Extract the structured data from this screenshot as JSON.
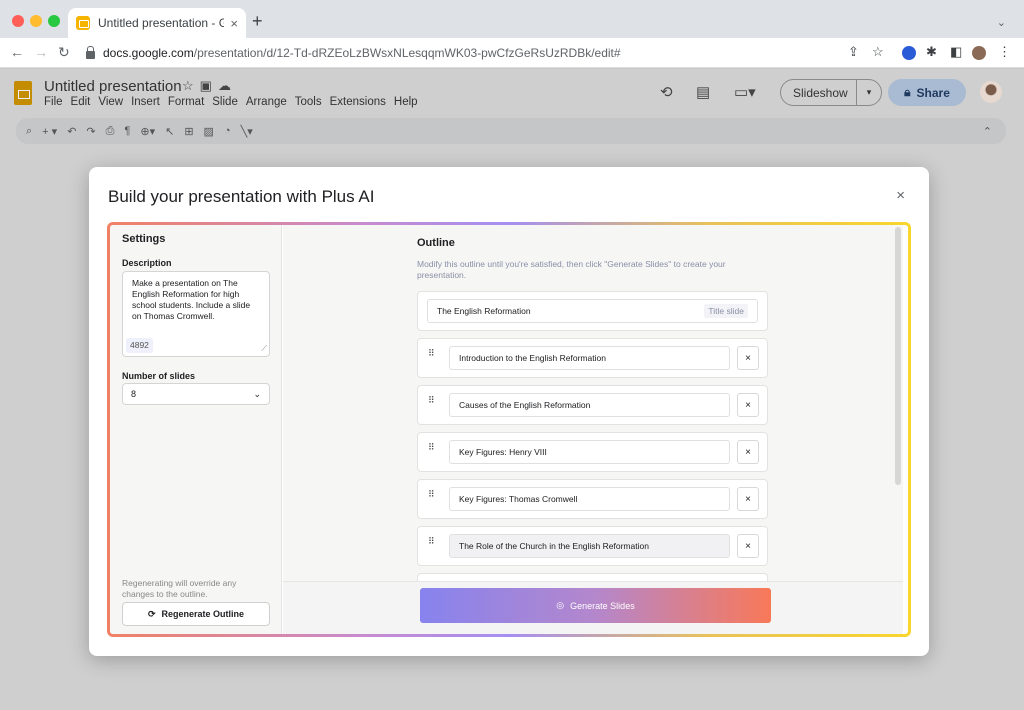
{
  "browser": {
    "tab_title": "Untitled presentation - Google",
    "tab_close": "×",
    "new_tab": "+",
    "url_host": "docs.google.com",
    "url_path": "/presentation/d/12-Td-dRZEoLzBWsxNLesqqmWK03-pwCfzGeRsUzRDBk/edit#"
  },
  "app": {
    "doc_title": "Untitled presentation",
    "menu": [
      "File",
      "Edit",
      "View",
      "Insert",
      "Format",
      "Slide",
      "Arrange",
      "Tools",
      "Extensions",
      "Help"
    ],
    "slideshow_label": "Slideshow",
    "share_label": "Share"
  },
  "modal": {
    "title": "Build your presentation with Plus AI",
    "close": "×"
  },
  "settings": {
    "title": "Settings",
    "description_label": "Description",
    "description_text": "Make a presentation on The English Reformation for high school students. Include a slide on Thomas Cromwell.",
    "char_count": "4892",
    "num_slides_label": "Number of slides",
    "num_slides_value": "8",
    "regen_note": "Regenerating will override any changes to the outline.",
    "regen_button": "Regenerate Outline"
  },
  "outline": {
    "title": "Outline",
    "subtitle": "Modify this outline until you're satisfied, then click \"Generate Slides\" to create your presentation.",
    "title_slide": "The English Reformation",
    "title_slide_tag": "Title slide",
    "items": [
      "Introduction to the English Reformation",
      "Causes of the English Reformation",
      "Key Figures: Henry VIII",
      "Key Figures: Thomas Cromwell",
      "The Role of the Church in the English Reformation"
    ],
    "remove": "×",
    "generate_button": "Generate Slides"
  },
  "colors": {
    "gradient_start": "#8783ee",
    "gradient_end": "#f87958",
    "frame_left": "#f08164",
    "frame_right": "#f8d62c"
  }
}
